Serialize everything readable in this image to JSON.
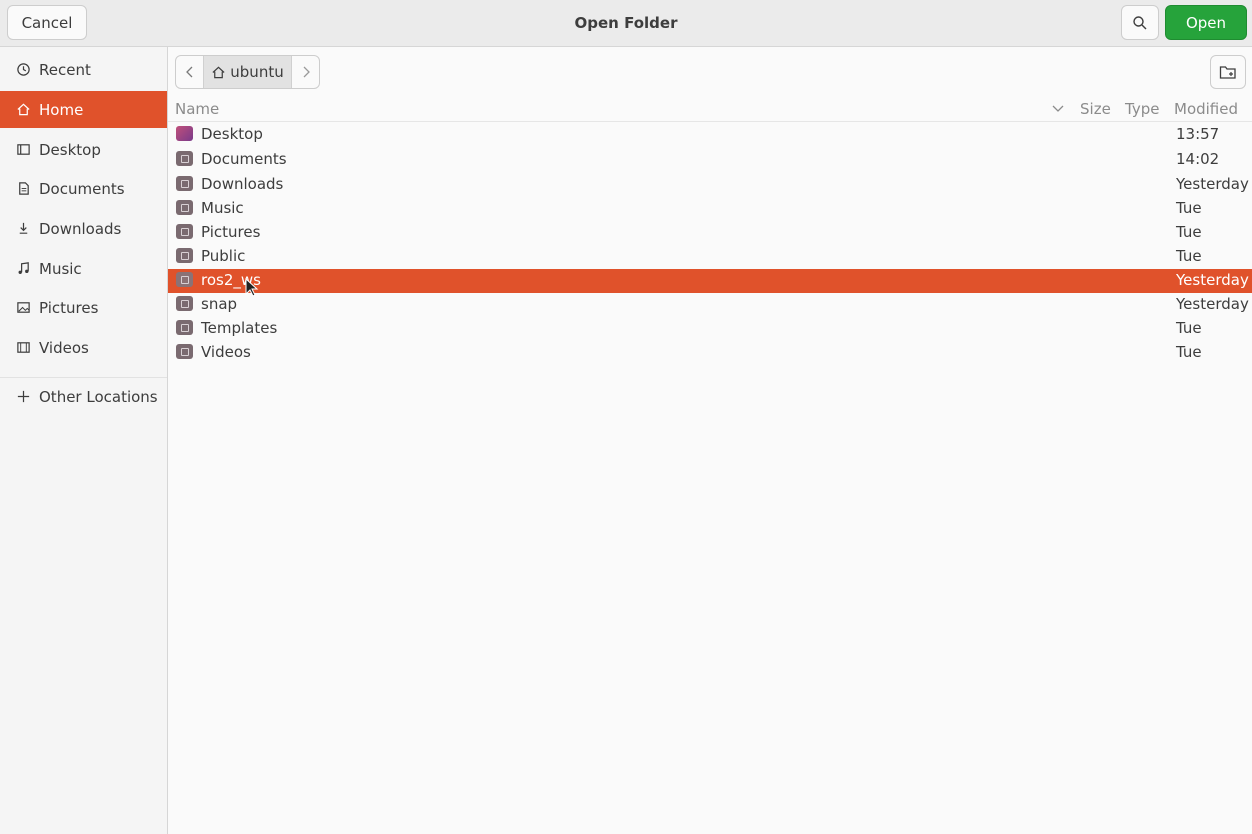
{
  "header": {
    "cancel_label": "Cancel",
    "title": "Open Folder",
    "open_label": "Open"
  },
  "sidebar": {
    "items": [
      {
        "label": "Recent",
        "icon": "clock-icon"
      },
      {
        "label": "Home",
        "icon": "home-icon",
        "active": true
      },
      {
        "label": "Desktop",
        "icon": "desktop-icon"
      },
      {
        "label": "Documents",
        "icon": "document-icon"
      },
      {
        "label": "Downloads",
        "icon": "download-icon"
      },
      {
        "label": "Music",
        "icon": "music-icon"
      },
      {
        "label": "Pictures",
        "icon": "picture-icon"
      },
      {
        "label": "Videos",
        "icon": "video-icon"
      }
    ],
    "other_locations": "Other Locations"
  },
  "pathbar": {
    "current": "ubuntu"
  },
  "columns": {
    "name": "Name",
    "size": "Size",
    "type": "Type",
    "modified": "Modified"
  },
  "files": [
    {
      "name": "Desktop",
      "modified": "13:57"
    },
    {
      "name": "Documents",
      "modified": "14:02"
    },
    {
      "name": "Downloads",
      "modified": "Yesterday"
    },
    {
      "name": "Music",
      "modified": "Tue"
    },
    {
      "name": "Pictures",
      "modified": "Tue"
    },
    {
      "name": "Public",
      "modified": "Tue"
    },
    {
      "name": "ros2_ws",
      "modified": "Yesterday",
      "selected": true
    },
    {
      "name": "snap",
      "modified": "Yesterday"
    },
    {
      "name": "Templates",
      "modified": "Tue"
    },
    {
      "name": "Videos",
      "modified": "Tue"
    }
  ],
  "colors": {
    "accent": "#e0522b",
    "open_button": "#26a33b"
  }
}
